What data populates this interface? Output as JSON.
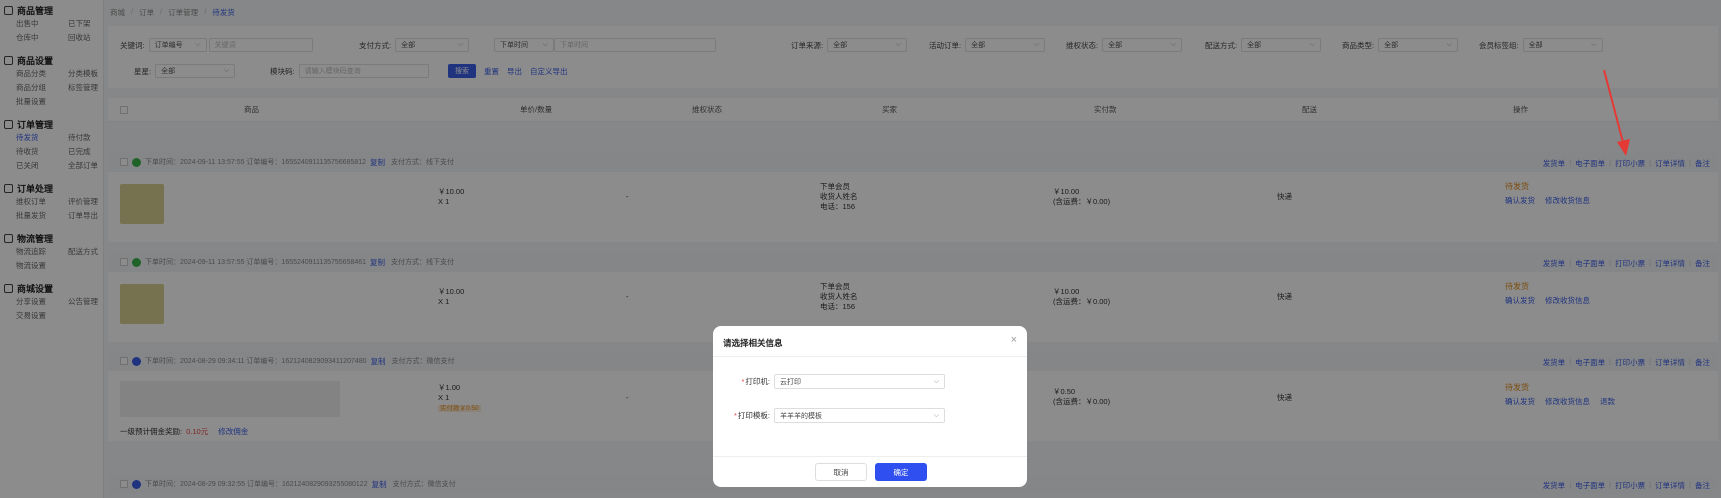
{
  "sidebar": {
    "groups": [
      {
        "title": "商品管理",
        "items": [
          "出售中",
          "已下架",
          "仓库中",
          "回收站"
        ]
      },
      {
        "title": "商品设置",
        "items": [
          "商品分类",
          "分类模板",
          "商品分组",
          "标签管理",
          "批量设置"
        ]
      },
      {
        "title": "订单管理",
        "items": [
          "待发货",
          "待付款",
          "待收货",
          "已完成",
          "已关闭",
          "全部订单"
        ],
        "active": "待发货"
      },
      {
        "title": "订单处理",
        "items": [
          "维权订单",
          "评价管理",
          "批量发货",
          "订单导出"
        ]
      },
      {
        "title": "物流管理",
        "items": [
          "物流追踪",
          "配送方式",
          "物流设置"
        ]
      },
      {
        "title": "商城设置",
        "items": [
          "分享设置",
          "公告管理",
          "交易设置"
        ]
      }
    ]
  },
  "breadcrumb": [
    "商城",
    "订单",
    "订单管理",
    "待发货"
  ],
  "filters": {
    "keyword_label": "关键词:",
    "keyword_type": "订单编号",
    "keyword_placeholder": "关键词",
    "pay_label": "支付方式:",
    "pay_value": "全部",
    "time_type": "下单时间",
    "time_placeholder": "下单时间",
    "source_label": "订单来源:",
    "source_value": "全部",
    "activity_label": "活动订单:",
    "activity_value": "全部",
    "rights_label": "维权状态:",
    "rights_value": "全部",
    "delivery_label": "配送方式:",
    "delivery_value": "全部",
    "goods_type_label": "商品类型:",
    "goods_type_value": "全部",
    "member_label": "会员标签组:",
    "member_value": "全部",
    "flag_label": "星星:",
    "flag_value": "全部",
    "tail_label": "模块码:",
    "tail_placeholder": "请输入模块码查询",
    "search_btn": "搜索",
    "reset_link": "重置",
    "export_link": "导出",
    "custom_export_link": "自定义导出"
  },
  "table_headers": [
    "商品",
    "单价/数量",
    "维权状态",
    "买家",
    "实付款",
    "配送",
    "操作"
  ],
  "ops": [
    "发货单",
    "电子面单",
    "打印小票",
    "订单详情",
    "备注"
  ],
  "orders": [
    {
      "meta": "下单时间：2024-09-11 13:57:55    订单编号：1655240911135756685812",
      "copy": "复制",
      "pay": "支付方式：线下支付",
      "price": "￥10.00",
      "qty": "X 1",
      "rights": "-",
      "buyer_1": "下单会员",
      "buyer_2": "收货人姓名",
      "buyer_3": "电话：156",
      "paid": "￥10.00",
      "freight": "(含运费：￥0.00)",
      "delivery": "快递",
      "status": "待发货",
      "act1": "确认发货",
      "act2": "修改收货信息"
    },
    {
      "meta": "下单时间：2024-09-11 13:57:55    订单编号：1655240911135755658461",
      "copy": "复制",
      "pay": "支付方式：线下支付",
      "price": "￥10.00",
      "qty": "X 1",
      "rights": "-",
      "buyer_1": "下单会员",
      "buyer_2": "收货人姓名",
      "buyer_3": "电话：156",
      "paid": "￥10.00",
      "freight": "(含运费：￥0.00)",
      "delivery": "快递",
      "status": "待发货",
      "act1": "确认发货",
      "act2": "修改收货信息"
    },
    {
      "meta": "下单时间：2024-08-29 09:34:11    订单编号：1621240829093411207480",
      "copy": "复制",
      "pay": "支付方式：微信支付",
      "price": "￥1.00",
      "qty": "X 1",
      "tag": "实付款￥0.50",
      "rights": "-",
      "paid": "￥0.50",
      "freight": "(含运费：￥0.00)",
      "delivery": "快递",
      "status": "待发货",
      "act1": "确认发货",
      "act2": "修改收货信息",
      "act3": "退款",
      "commission_label": "一级预计佣金奖励:",
      "commission_value": "0.10元",
      "commission_link": "修改佣金"
    },
    {
      "meta": "下单时间：2024-08-29 09:32:55    订单编号：1621240829093255080122",
      "copy": "复制",
      "pay": "支付方式：微信支付"
    }
  ],
  "modal": {
    "title": "请选择相关信息",
    "printer_label": "打印机:",
    "printer_value": "云打印",
    "template_label": "打印模板:",
    "template_value": "羊羊羊的模板",
    "cancel": "取消",
    "ok": "确定"
  },
  "colors": {
    "accent": "#3a5ee8",
    "warning": "#e08c1a",
    "arrow": "#e53935"
  }
}
